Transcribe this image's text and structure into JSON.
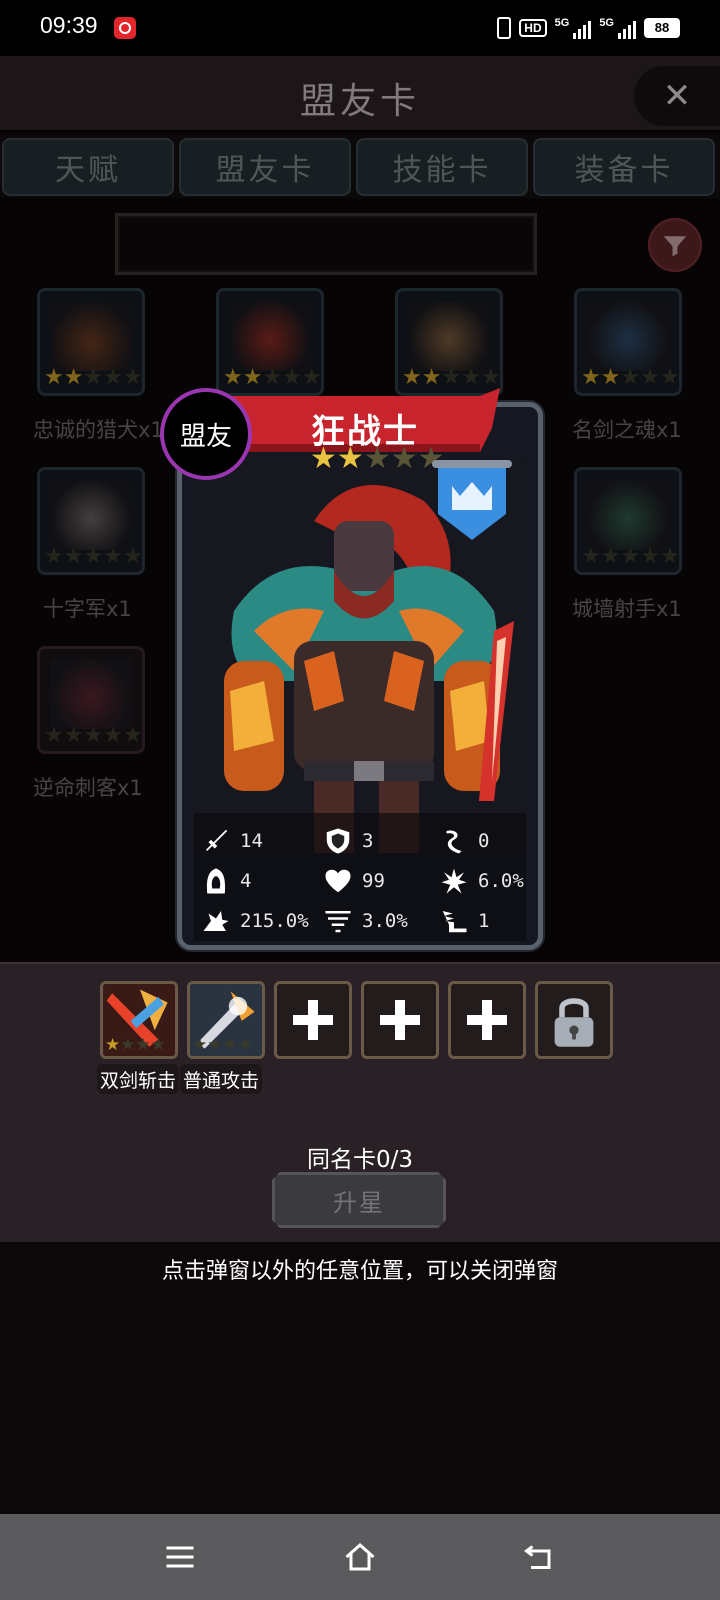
{
  "status_bar": {
    "time": "09:39",
    "hd": "HD",
    "signal_1": "5G",
    "signal_2": "5G",
    "battery": "88"
  },
  "header": {
    "title": "盟友卡",
    "close_icon": "close-icon"
  },
  "tabs": [
    {
      "label": "天赋"
    },
    {
      "label": "盟友卡"
    },
    {
      "label": "技能卡"
    },
    {
      "label": "装备卡"
    }
  ],
  "search": {
    "value": "",
    "filter_icon": "filter-icon"
  },
  "grid": {
    "cards": [
      {
        "name": "忠诚的猎犬x1",
        "stars": 2
      },
      {
        "name": "",
        "stars": 2
      },
      {
        "name": "",
        "stars": 2
      },
      {
        "name": "名剑之魂x1",
        "stars": 2
      },
      {
        "name": "十字军x1",
        "stars": 0
      },
      {
        "name": "城墙射手x1",
        "stars": 0
      },
      {
        "name": "逆命刺客x1",
        "stars": 0
      }
    ]
  },
  "hero": {
    "badge": "盟友",
    "name": "狂战士",
    "stars": 2,
    "max_stars": 5,
    "stats": {
      "attack": "14",
      "armor": "3",
      "regen": "0",
      "dodge": "4",
      "hp": "99",
      "crit": "6.0%",
      "crit_damage": "215.0%",
      "evasion": "3.0%",
      "speed": "1"
    }
  },
  "skills": {
    "slot_labels": [
      "双剑斩击",
      "普通攻击"
    ],
    "slot1_stars": 1,
    "slot2_stars": 0
  },
  "duplicate": {
    "label": "同名卡0/3"
  },
  "upgrade": {
    "label": "升星"
  },
  "hint": {
    "text": "点击弹窗以外的任意位置，可以关闭弹窗"
  },
  "colors": {
    "banner_red": "#c8242e",
    "ally_ring": "#9b36b3",
    "star_on": "#e8c341",
    "crown_blue": "#3b8fe0"
  }
}
